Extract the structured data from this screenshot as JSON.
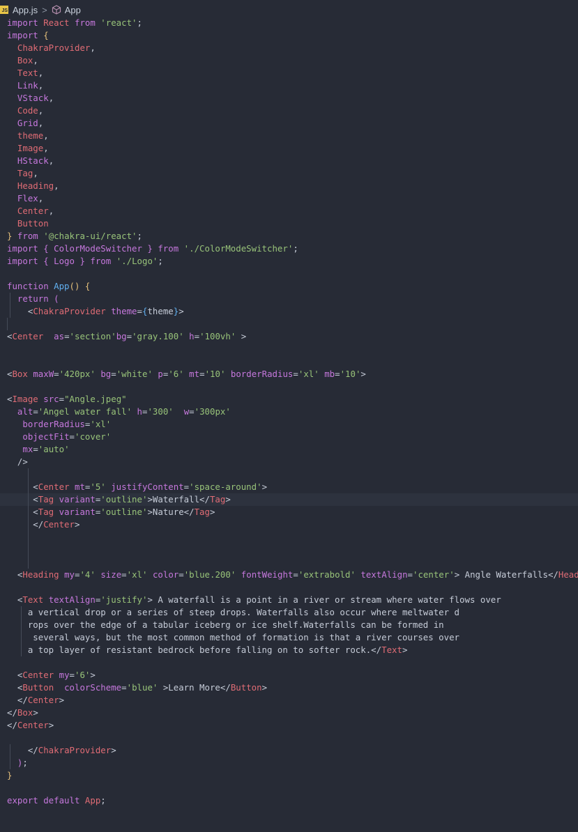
{
  "breadcrumb": {
    "badge": "JS",
    "file": "App.js",
    "separator": ">",
    "symbol": "App"
  },
  "editor": {
    "language": "javascript",
    "active_line": 38
  },
  "code_lines": [
    [
      [
        "kw",
        "import "
      ],
      [
        "id",
        "React "
      ],
      [
        "kw",
        "from "
      ],
      [
        "str",
        "'react'"
      ],
      [
        "plain",
        ";"
      ]
    ],
    [
      [
        "kw",
        "import "
      ],
      [
        "brace",
        "{"
      ]
    ],
    [
      [
        "plain",
        "  "
      ],
      [
        "id",
        "ChakraProvider"
      ],
      [
        "plain",
        ","
      ]
    ],
    [
      [
        "plain",
        "  "
      ],
      [
        "id",
        "Box"
      ],
      [
        "plain",
        ","
      ]
    ],
    [
      [
        "plain",
        "  "
      ],
      [
        "id",
        "Text"
      ],
      [
        "plain",
        ","
      ]
    ],
    [
      [
        "plain",
        "  "
      ],
      [
        "idv",
        "Link"
      ],
      [
        "plain",
        ","
      ]
    ],
    [
      [
        "plain",
        "  "
      ],
      [
        "idv",
        "VStack"
      ],
      [
        "plain",
        ","
      ]
    ],
    [
      [
        "plain",
        "  "
      ],
      [
        "id",
        "Code"
      ],
      [
        "plain",
        ","
      ]
    ],
    [
      [
        "plain",
        "  "
      ],
      [
        "idv",
        "Grid"
      ],
      [
        "plain",
        ","
      ]
    ],
    [
      [
        "plain",
        "  "
      ],
      [
        "id",
        "theme"
      ],
      [
        "plain",
        ","
      ]
    ],
    [
      [
        "plain",
        "  "
      ],
      [
        "id",
        "Image"
      ],
      [
        "plain",
        ","
      ]
    ],
    [
      [
        "plain",
        "  "
      ],
      [
        "idv",
        "HStack"
      ],
      [
        "plain",
        ","
      ]
    ],
    [
      [
        "plain",
        "  "
      ],
      [
        "id",
        "Tag"
      ],
      [
        "plain",
        ","
      ]
    ],
    [
      [
        "plain",
        "  "
      ],
      [
        "id",
        "Heading"
      ],
      [
        "plain",
        ","
      ]
    ],
    [
      [
        "plain",
        "  "
      ],
      [
        "idv",
        "Flex"
      ],
      [
        "plain",
        ","
      ]
    ],
    [
      [
        "plain",
        "  "
      ],
      [
        "id",
        "Center"
      ],
      [
        "plain",
        ","
      ]
    ],
    [
      [
        "plain",
        "  "
      ],
      [
        "id",
        "Button"
      ]
    ],
    [
      [
        "brace",
        "} "
      ],
      [
        "kw",
        "from "
      ],
      [
        "str",
        "'@chakra-ui/react'"
      ],
      [
        "plain",
        ";"
      ]
    ],
    [
      [
        "kw",
        "import "
      ],
      [
        "brace2",
        "{ "
      ],
      [
        "idv",
        "ColorModeSwitcher "
      ],
      [
        "brace2",
        "} "
      ],
      [
        "kw",
        "from "
      ],
      [
        "str",
        "'./ColorModeSwitcher'"
      ],
      [
        "plain",
        ";"
      ]
    ],
    [
      [
        "kw",
        "import "
      ],
      [
        "brace2",
        "{ "
      ],
      [
        "idv",
        "Logo "
      ],
      [
        "brace2",
        "} "
      ],
      [
        "kw",
        "from "
      ],
      [
        "str",
        "'./Logo'"
      ],
      [
        "plain",
        ";"
      ]
    ],
    [],
    [
      [
        "kw",
        "function "
      ],
      [
        "fn",
        "App"
      ],
      [
        "brace",
        "() {"
      ]
    ],
    [
      [
        "plain",
        "  "
      ],
      [
        "kw",
        "return "
      ],
      [
        "brace2",
        "("
      ]
    ],
    [
      [
        "plain",
        "    <"
      ],
      [
        "tag",
        "ChakraProvider "
      ],
      [
        "attr",
        "theme"
      ],
      [
        "plain",
        "="
      ],
      [
        "brace3",
        "{"
      ],
      [
        "plain",
        "theme"
      ],
      [
        "brace3",
        "}"
      ],
      [
        "plain",
        ">"
      ]
    ],
    [],
    [
      [
        "plain",
        "<"
      ],
      [
        "tag",
        "Center  "
      ],
      [
        "attr",
        "as"
      ],
      [
        "plain",
        "="
      ],
      [
        "str",
        "'section'"
      ],
      [
        "attr",
        "bg"
      ],
      [
        "plain",
        "="
      ],
      [
        "str",
        "'gray.100' "
      ],
      [
        "attr",
        "h"
      ],
      [
        "plain",
        "="
      ],
      [
        "str",
        "'100vh' "
      ],
      [
        "plain",
        ">"
      ]
    ],
    [],
    [],
    [
      [
        "plain",
        "<"
      ],
      [
        "tag",
        "Box "
      ],
      [
        "attr",
        "maxW"
      ],
      [
        "plain",
        "="
      ],
      [
        "str",
        "'420px' "
      ],
      [
        "attr",
        "bg"
      ],
      [
        "plain",
        "="
      ],
      [
        "str",
        "'white' "
      ],
      [
        "attr",
        "p"
      ],
      [
        "plain",
        "="
      ],
      [
        "str",
        "'6' "
      ],
      [
        "attr",
        "mt"
      ],
      [
        "plain",
        "="
      ],
      [
        "str",
        "'10' "
      ],
      [
        "attr",
        "borderRadius"
      ],
      [
        "plain",
        "="
      ],
      [
        "str",
        "'xl' "
      ],
      [
        "attr",
        "mb"
      ],
      [
        "plain",
        "="
      ],
      [
        "str",
        "'10'"
      ],
      [
        "plain",
        ">"
      ]
    ],
    [],
    [
      [
        "plain",
        "<"
      ],
      [
        "tag",
        "Image "
      ],
      [
        "attr",
        "src"
      ],
      [
        "plain",
        "="
      ],
      [
        "str",
        "\"Angle.jpeg\""
      ]
    ],
    [
      [
        "plain",
        "  "
      ],
      [
        "attr",
        "alt"
      ],
      [
        "plain",
        "="
      ],
      [
        "str",
        "'Angel water fall' "
      ],
      [
        "attr",
        "h"
      ],
      [
        "plain",
        "="
      ],
      [
        "str",
        "'300'  "
      ],
      [
        "attr",
        "w"
      ],
      [
        "plain",
        "="
      ],
      [
        "str",
        "'300px'"
      ]
    ],
    [
      [
        "plain",
        "   "
      ],
      [
        "attr",
        "borderRadius"
      ],
      [
        "plain",
        "="
      ],
      [
        "str",
        "'xl'"
      ]
    ],
    [
      [
        "plain",
        "   "
      ],
      [
        "attr",
        "objectFit"
      ],
      [
        "plain",
        "="
      ],
      [
        "str",
        "'cover'"
      ]
    ],
    [
      [
        "plain",
        "   "
      ],
      [
        "attr",
        "mx"
      ],
      [
        "plain",
        "="
      ],
      [
        "str",
        "'auto'"
      ]
    ],
    [
      [
        "plain",
        "  />"
      ]
    ],
    [],
    [
      [
        "plain",
        "     <"
      ],
      [
        "tag",
        "Center "
      ],
      [
        "attr",
        "mt"
      ],
      [
        "plain",
        "="
      ],
      [
        "str",
        "'5' "
      ],
      [
        "attr",
        "justifyContent"
      ],
      [
        "plain",
        "="
      ],
      [
        "str",
        "'space-around'"
      ],
      [
        "plain",
        ">"
      ]
    ],
    [
      [
        "plain",
        "     <"
      ],
      [
        "tag",
        "Tag "
      ],
      [
        "attr",
        "variant"
      ],
      [
        "plain",
        "="
      ],
      [
        "str",
        "'outline'"
      ],
      [
        "plain",
        ">Waterfall</"
      ],
      [
        "tag",
        "Tag"
      ],
      [
        "plain",
        ">"
      ]
    ],
    [
      [
        "plain",
        "     <"
      ],
      [
        "tag",
        "Tag "
      ],
      [
        "attr",
        "variant"
      ],
      [
        "plain",
        "="
      ],
      [
        "str",
        "'outline'"
      ],
      [
        "plain",
        ">Nature</"
      ],
      [
        "tag",
        "Tag"
      ],
      [
        "plain",
        ">"
      ]
    ],
    [
      [
        "plain",
        "     </"
      ],
      [
        "tag",
        "Center"
      ],
      [
        "plain",
        ">"
      ]
    ],
    [],
    [],
    [],
    [
      [
        "plain",
        "  <"
      ],
      [
        "tag",
        "Heading "
      ],
      [
        "attr",
        "my"
      ],
      [
        "plain",
        "="
      ],
      [
        "str",
        "'4' "
      ],
      [
        "attr",
        "size"
      ],
      [
        "plain",
        "="
      ],
      [
        "str",
        "'xl' "
      ],
      [
        "attr",
        "color"
      ],
      [
        "plain",
        "="
      ],
      [
        "str",
        "'blue.200' "
      ],
      [
        "attr",
        "fontWeight"
      ],
      [
        "plain",
        "="
      ],
      [
        "str",
        "'extrabold' "
      ],
      [
        "attr",
        "textAlign"
      ],
      [
        "plain",
        "="
      ],
      [
        "str",
        "'center'"
      ],
      [
        "plain",
        "> Angle Waterfalls</"
      ],
      [
        "tag",
        "Heading"
      ],
      [
        "plain",
        ">"
      ]
    ],
    [],
    [
      [
        "plain",
        "  <"
      ],
      [
        "tag",
        "Text "
      ],
      [
        "attr",
        "textAlign"
      ],
      [
        "plain",
        "="
      ],
      [
        "str",
        "'justify'"
      ],
      [
        "plain",
        "> A waterfall is a point in a river or stream where water flows over"
      ]
    ],
    [
      [
        "plain",
        "    a vertical drop or a series of steep drops. Waterfalls also occur where meltwater d"
      ]
    ],
    [
      [
        "plain",
        "    rops over the edge of a tabular iceberg or ice shelf.Waterfalls can be formed in"
      ]
    ],
    [
      [
        "plain",
        "     several ways, but the most common method of formation is that a river courses over"
      ]
    ],
    [
      [
        "plain",
        "    a top layer of resistant bedrock before falling on to softer rock.</"
      ],
      [
        "tag",
        "Text"
      ],
      [
        "plain",
        ">"
      ]
    ],
    [],
    [
      [
        "plain",
        "  <"
      ],
      [
        "tag",
        "Center "
      ],
      [
        "attr",
        "my"
      ],
      [
        "plain",
        "="
      ],
      [
        "str",
        "'6'"
      ],
      [
        "plain",
        ">"
      ]
    ],
    [
      [
        "plain",
        "  <"
      ],
      [
        "tag",
        "Button  "
      ],
      [
        "attr",
        "colorScheme"
      ],
      [
        "plain",
        "="
      ],
      [
        "str",
        "'blue' "
      ],
      [
        "plain",
        ">Learn More</"
      ],
      [
        "tag",
        "Button"
      ],
      [
        "plain",
        ">"
      ]
    ],
    [
      [
        "plain",
        "  </"
      ],
      [
        "tag",
        "Center"
      ],
      [
        "plain",
        ">"
      ]
    ],
    [
      [
        "plain",
        "</"
      ],
      [
        "tag",
        "Box"
      ],
      [
        "plain",
        ">"
      ]
    ],
    [
      [
        "plain",
        "</"
      ],
      [
        "tag",
        "Center"
      ],
      [
        "plain",
        ">"
      ]
    ],
    [],
    [
      [
        "plain",
        "    </"
      ],
      [
        "tag",
        "ChakraProvider"
      ],
      [
        "plain",
        ">"
      ]
    ],
    [
      [
        "plain",
        "  "
      ],
      [
        "brace2",
        ")"
      ],
      [
        "plain",
        ";"
      ]
    ],
    [
      [
        "brace",
        "}"
      ]
    ],
    [],
    [
      [
        "kw",
        "export "
      ],
      [
        "kw",
        "default "
      ],
      [
        "id",
        "App"
      ],
      [
        "plain",
        ";"
      ]
    ]
  ]
}
